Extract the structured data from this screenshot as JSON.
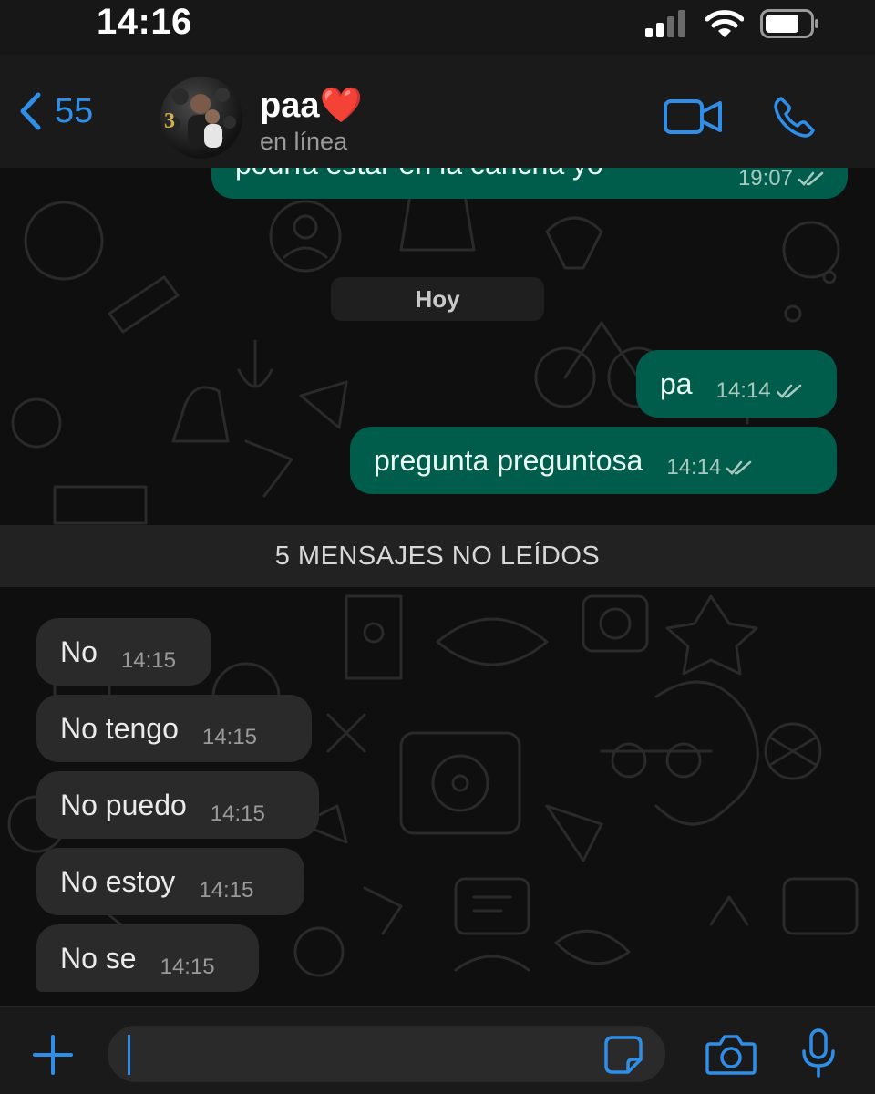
{
  "status_bar": {
    "time": "14:16"
  },
  "header": {
    "back_count": "55",
    "contact_name": "paa",
    "contact_emoji": "❤️",
    "contact_status": "en línea"
  },
  "chat": {
    "previous_message": {
      "text": "podría estar en la cancha yo",
      "time": "19:07"
    },
    "date_divider": "Hoy",
    "outgoing": [
      {
        "text": "pa",
        "time": "14:14"
      },
      {
        "text": "pregunta preguntosa",
        "time": "14:14"
      }
    ],
    "unread_banner": "5 MENSAJES NO LEÍDOS",
    "incoming": [
      {
        "text": "No",
        "time": "14:15"
      },
      {
        "text": "No tengo",
        "time": "14:15"
      },
      {
        "text": "No puedo",
        "time": "14:15"
      },
      {
        "text": "No estoy",
        "time": "14:15"
      },
      {
        "text": "No se",
        "time": "14:15"
      }
    ]
  },
  "composer": {
    "value": ""
  },
  "colors": {
    "accent": "#2f8fe8",
    "outgoing_bubble": "#005c4b",
    "incoming_bubble": "#2a2a2a",
    "background": "#0f0f0f"
  },
  "icons": [
    "signal-icon",
    "wifi-icon",
    "battery-icon",
    "back-chevron-icon",
    "video-call-icon",
    "phone-icon",
    "read-receipt-icon",
    "plus-icon",
    "sticker-icon",
    "camera-icon",
    "microphone-icon"
  ]
}
